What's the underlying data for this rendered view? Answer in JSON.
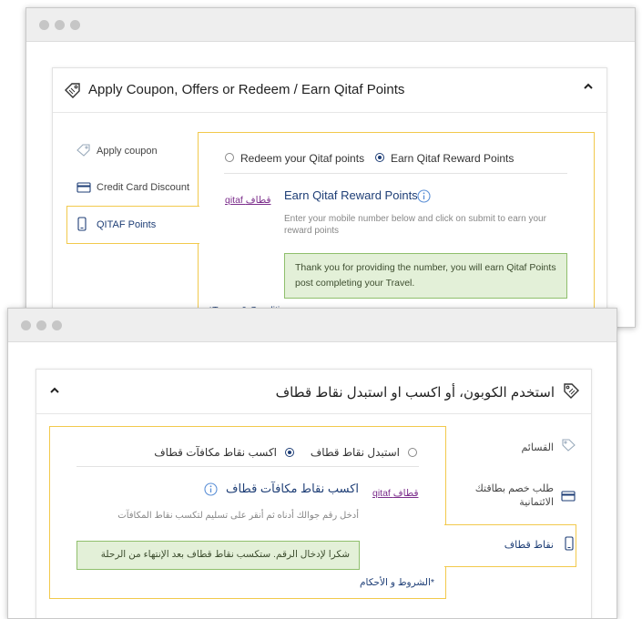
{
  "en": {
    "header_title": "Apply Coupon, Offers or Redeem / Earn Qitaf Points",
    "sidebar": [
      {
        "label": "Apply coupon",
        "icon": "tag-icon"
      },
      {
        "label": "Credit Card Discount",
        "icon": "credit-card-icon"
      },
      {
        "label": "QITAF Points",
        "icon": "mobile-phone-icon"
      }
    ],
    "options": {
      "redeem": "Redeem your Qitaf points",
      "earn": "Earn Qitaf Reward Points"
    },
    "logo_text": "qitaf قطاف",
    "earn_title": "Earn Qitaf Reward Points",
    "help_text": "Enter your mobile number below and click on submit to earn your reward points",
    "notice": "Thank you for providing the number, you will earn Qitaf Points post completing your Travel.",
    "terms": "*Terms & Conditions"
  },
  "ar": {
    "header_title": "استخدم الكوبون، أو اكسب او استبدل نقاط قطاف",
    "sidebar": [
      {
        "label": "القسائم",
        "icon": "tag-icon"
      },
      {
        "label": "طلب خصم بطاقتك الائتمانية",
        "icon": "credit-card-icon"
      },
      {
        "label": "نقاط قطاف",
        "icon": "mobile-phone-icon"
      }
    ],
    "options": {
      "redeem": "استبدل نقاط قطاف",
      "earn": "اكسب نقاط مكافآت قطاف"
    },
    "logo_text": "qitaf قطاف",
    "earn_title": "اكسب نقاط مكافآت قطاف",
    "help_text": "أدخل رقم جوالك أدناه ثم أنقر على تسليم لتكسب نقاط المكافآت",
    "notice": "شكرا لإدخال الرقم. ستكسب نقاط قطاف بعد الإنتهاء من الرحلة",
    "terms": "*الشروط و الأحكام"
  },
  "colors": {
    "accent_border": "#f2c94c",
    "brand_blue": "#1e3e76",
    "notice_bg": "#e3f0d8",
    "qitaf_purple": "#7b2d8b"
  }
}
